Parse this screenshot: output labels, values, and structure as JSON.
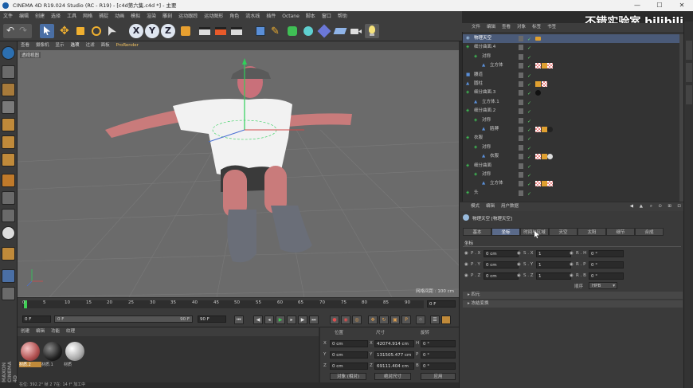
{
  "window": {
    "title": "CINEMA 4D R19.024 Studio (RC - R19) - [c4d第六集.c4d *] - 主要",
    "controls": [
      "—",
      "☐",
      "✕"
    ]
  },
  "menubar": [
    "文件",
    "编辑",
    "创建",
    "选择",
    "工具",
    "网格",
    "捕捉",
    "动画",
    "模拟",
    "渲染",
    "雕刻",
    "运动跟踪",
    "运动图形",
    "角色",
    "流水线",
    "插件",
    "Octane",
    "脚本",
    "窗口",
    "帮助"
  ],
  "toolbar": {
    "axis_x": "X",
    "axis_y": "Y",
    "axis_z": "Z"
  },
  "viewport": {
    "menu": [
      "查看",
      "摄像机",
      "显示",
      "选项",
      "过滤",
      "面板",
      "ProRender"
    ],
    "label": "透视视图",
    "grid_info": "网格间距 : 100 cm",
    "bg_color": "#6b6b6b"
  },
  "timeline": {
    "ticks": [
      "0",
      "5",
      "10",
      "15",
      "20",
      "25",
      "30",
      "35",
      "40",
      "45",
      "50",
      "55",
      "60",
      "65",
      "70",
      "75",
      "80",
      "85",
      "90"
    ],
    "end_label": "0 F",
    "start_field": "0 F",
    "range_start": "0 F",
    "range_end": "90 F",
    "end_field": "90 F"
  },
  "materials": {
    "menu": [
      "创建",
      "编辑",
      "功能",
      "纹理"
    ],
    "items": [
      "材质.2",
      "材质.1",
      "材质"
    ]
  },
  "coords": {
    "headers": [
      "位置",
      "尺寸",
      "旋转"
    ],
    "rows": [
      {
        "axis": "X",
        "pos": "0 cm",
        "size_axis": "X",
        "size": "42074.914 cm",
        "rot_axis": "H",
        "rot": "0 °"
      },
      {
        "axis": "Y",
        "pos": "0 cm",
        "size_axis": "Y",
        "size": "131505.477 cm",
        "rot_axis": "P",
        "rot": "0 °"
      },
      {
        "axis": "Z",
        "pos": "0 cm",
        "size_axis": "Z",
        "size": "69111.404 cm",
        "rot_axis": "B",
        "rot": "0 °"
      }
    ],
    "mode": "对象 (相对)",
    "size_mode": "绝对尺寸",
    "apply": "应用"
  },
  "status": "在位: 392.2° 帧 2 7在: 14 f° 加工中",
  "objects": {
    "menu": [
      "文件",
      "编辑",
      "查看",
      "对象",
      "标签",
      "书签"
    ],
    "rows": [
      {
        "name": "物理天空",
        "indent": 0
      },
      {
        "name": "细分曲面.4",
        "indent": 0
      },
      {
        "name": "对称",
        "indent": 1
      },
      {
        "name": "立方体",
        "indent": 2
      },
      {
        "name": "腰道",
        "indent": 0
      },
      {
        "name": "圆柱",
        "indent": 0
      },
      {
        "name": "细分曲面.3",
        "indent": 0
      },
      {
        "name": "立方体.1",
        "indent": 1
      },
      {
        "name": "细分曲面.2",
        "indent": 0
      },
      {
        "name": "对称",
        "indent": 1
      },
      {
        "name": "胳膊",
        "indent": 2
      },
      {
        "name": "衣服",
        "indent": 0
      },
      {
        "name": "对称",
        "indent": 1
      },
      {
        "name": "衣服",
        "indent": 2
      },
      {
        "name": "细分曲面",
        "indent": 0
      },
      {
        "name": "对称",
        "indent": 1
      },
      {
        "name": "立方体",
        "indent": 2
      },
      {
        "name": "头",
        "indent": 0
      }
    ]
  },
  "attributes": {
    "menu": [
      "模式",
      "编辑",
      "用户数据"
    ],
    "object_title": "物理天空 [物理天空]",
    "tabs": [
      "基本",
      "坐标",
      "时间与区域",
      "天空",
      "太阳",
      "细节",
      "合成"
    ],
    "active_tab": "坐标",
    "section": "坐标",
    "rows": [
      {
        "pl": "P . X",
        "pv": "0 cm",
        "sl": "S . X",
        "sv": "1",
        "rl": "R . H",
        "rv": "0 °"
      },
      {
        "pl": "P . Y",
        "pv": "0 cm",
        "sl": "S . Y",
        "sv": "1",
        "rl": "R . P",
        "rv": "0 °"
      },
      {
        "pl": "P . Z",
        "pv": "0 cm",
        "sl": "S . Z",
        "sv": "1",
        "rl": "R . B",
        "rv": "0 °"
      }
    ],
    "order_label": "顺序",
    "order_value": "HPB",
    "collapsed": [
      "四元",
      "冻结变换"
    ]
  },
  "watermark": "不错实验室 bilibili",
  "side_label": "MAXON CINEMA 4D"
}
